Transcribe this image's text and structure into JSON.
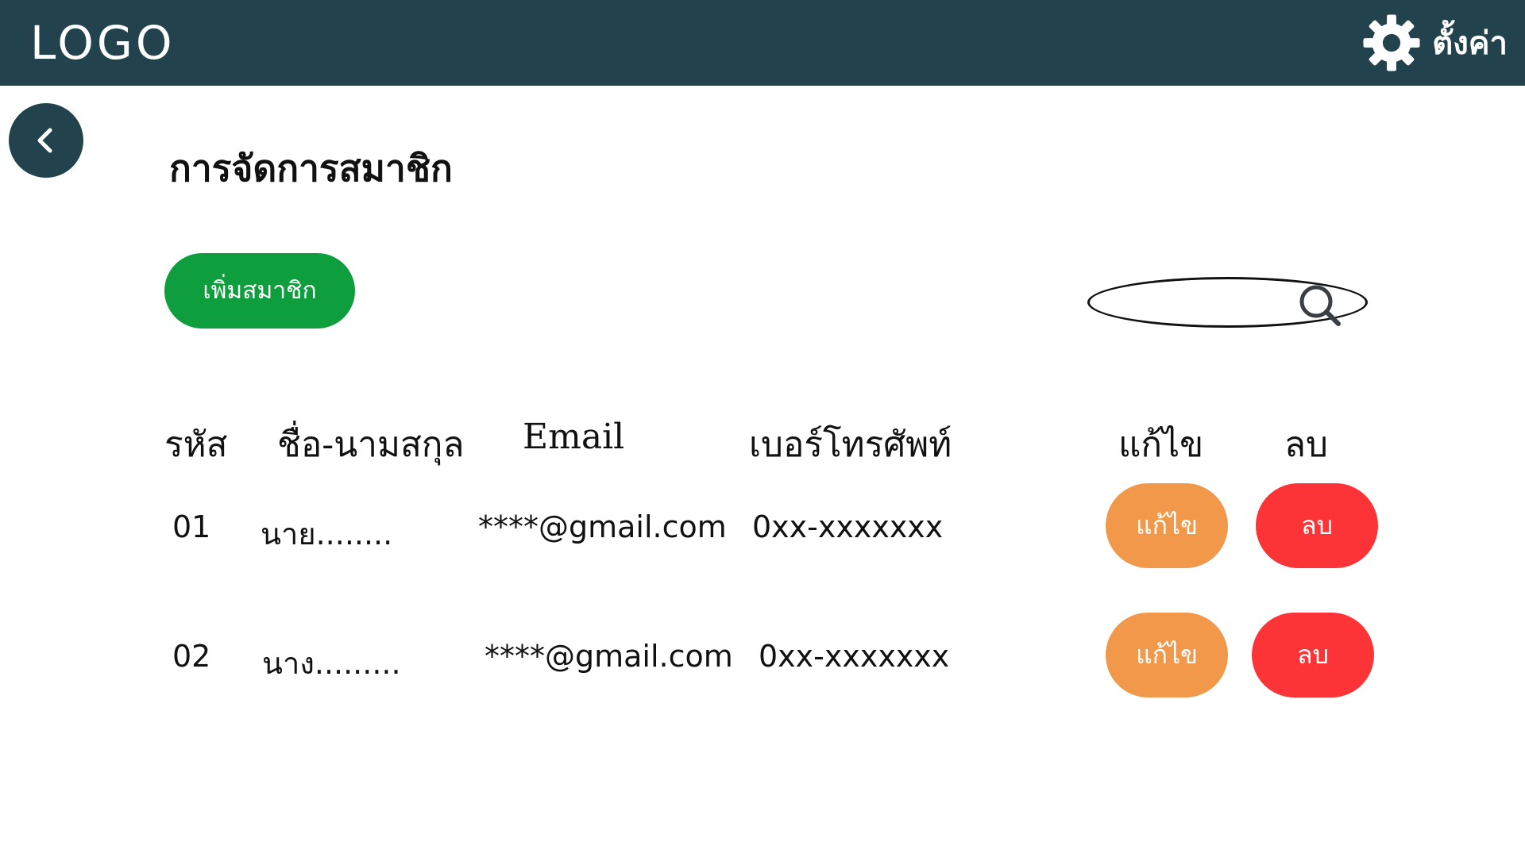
{
  "header": {
    "logo": "LOGO",
    "settings_label": "ตั้งค่า"
  },
  "colors": {
    "header_bg": "#22434e",
    "add_button": "#0f9e3e",
    "edit_button": "#f2984a",
    "delete_button": "#fd3437"
  },
  "icons": {
    "settings": "gear-icon",
    "back": "chevron-left-icon",
    "search": "search-icon"
  },
  "page": {
    "title": "การจัดการสมาชิก",
    "add_member_label": "เพิ่มสมาชิก"
  },
  "search": {
    "value": "",
    "placeholder": ""
  },
  "table": {
    "headers": {
      "id": "รหัส",
      "name": "ชื่อ-นามสกุล",
      "email": "Email",
      "phone": "เบอร์โทรศัพท์",
      "edit": "แก้ไข",
      "delete": "ลบ"
    },
    "rows": [
      {
        "id": "01",
        "name": "นาย........",
        "email": "****@gmail.com",
        "phone": "0xx-xxxxxxx",
        "edit_label": "แก้ไข",
        "delete_label": "ลบ"
      },
      {
        "id": "02",
        "name": "นาง.........",
        "email": "****@gmail.com",
        "phone": "0xx-xxxxxxx",
        "edit_label": "แก้ไข",
        "delete_label": "ลบ"
      }
    ]
  }
}
